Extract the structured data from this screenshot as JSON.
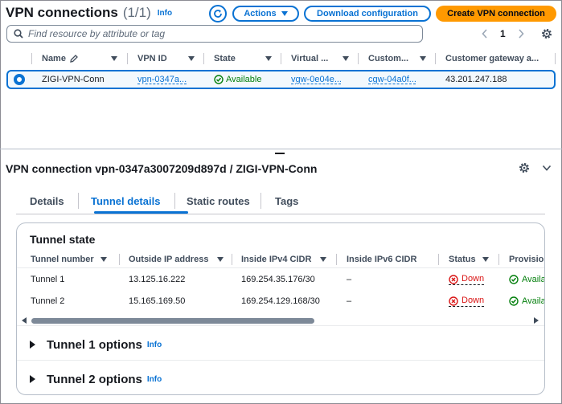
{
  "header": {
    "title": "VPN connections",
    "count": "(1/1)",
    "info": "Info",
    "actions_label": "Actions",
    "download_label": "Download configuration",
    "create_label": "Create VPN connection"
  },
  "search": {
    "placeholder": "Find resource by attribute or tag"
  },
  "pagination": {
    "current_page": "1"
  },
  "table": {
    "columns": [
      "Name",
      "VPN ID",
      "State",
      "Virtual ...",
      "Custom...",
      "Customer gateway a..."
    ],
    "rows": [
      {
        "name": "ZIGI-VPN-Conn",
        "vpn_id": "vpn-0347a...",
        "state": "Available",
        "virtual_gateway": "vgw-0e04e...",
        "customer_gateway": "cgw-04a0f...",
        "customer_gateway_address": "43.201.247.188"
      }
    ]
  },
  "detail": {
    "title": "VPN connection vpn-0347a3007209d897d / ZIGI-VPN-Conn",
    "tabs": [
      "Details",
      "Tunnel details",
      "Static routes",
      "Tags"
    ],
    "active_tab": "Tunnel details",
    "tunnel_state": {
      "title": "Tunnel state",
      "columns": [
        "Tunnel number",
        "Outside IP address",
        "Inside IPv4 CIDR",
        "Inside IPv6 CIDR",
        "Status",
        "Provisio"
      ],
      "rows": [
        {
          "tunnel": "Tunnel 1",
          "outside_ip": "13.125.16.222",
          "ipv4": "169.254.35.176/30",
          "ipv6": "–",
          "status": "Down",
          "provision": "Availa"
        },
        {
          "tunnel": "Tunnel 2",
          "outside_ip": "15.165.169.50",
          "ipv4": "169.254.129.168/30",
          "ipv6": "–",
          "status": "Down",
          "provision": "Availa"
        }
      ]
    },
    "tunnel1_options": "Tunnel 1 options",
    "tunnel2_options": "Tunnel 2 options",
    "info": "Info"
  },
  "colors": {
    "accent": "#0972d3",
    "primary_button": "#ff9900",
    "success": "#037f0c",
    "error": "#d91515"
  },
  "icons": [
    "refresh-icon",
    "search-icon",
    "chevron-left-icon",
    "chevron-right-icon",
    "gear-icon",
    "pencil-icon",
    "check-circle-icon",
    "x-circle-icon",
    "chevron-down-icon",
    "caret-right-icon"
  ]
}
